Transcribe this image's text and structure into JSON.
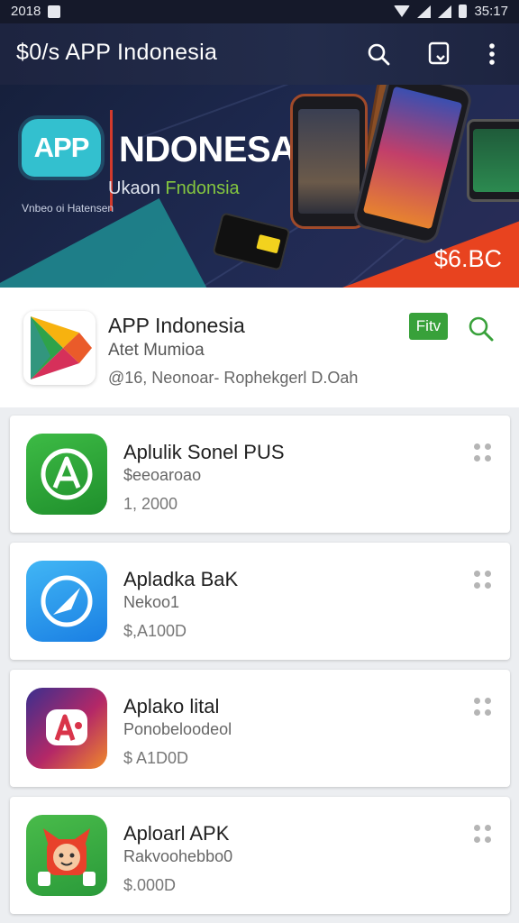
{
  "status_bar": {
    "time_left": "2018",
    "time_right": "35:17"
  },
  "appbar": {
    "title": "$0/s APP  Indonesia",
    "icons": [
      "search-icon",
      "bookmark-icon",
      "more-vert-icon"
    ]
  },
  "banner": {
    "badge": "APP",
    "headline": "NDONESA",
    "sub_prefix": "Ukaon ",
    "sub_accent": "Fndonsia",
    "tagline": "Vnbeo oi Hatensen",
    "price": "$6.BC"
  },
  "featured": {
    "name": "APP Indonesia",
    "developer": "Atet Mumioa",
    "meta": "@16, Neonoar- Rophekgerl D.Oah",
    "install_label": "Fitv"
  },
  "apps": [
    {
      "name": "Aplulik Sonel PUS",
      "sub": "$eeoaroao",
      "price": "1, 2000"
    },
    {
      "name": "Apladka BaK",
      "sub": "Nekoo1",
      "price": "$,A100D"
    },
    {
      "name": "Aplako lital",
      "sub": "Ponobeloodeol",
      "price": "$ A1D0D"
    },
    {
      "name": "Aploarl APK",
      "sub": "Rakvoohebbo0",
      "price": "$.000D"
    }
  ],
  "colors": {
    "appbar_bg": "#1d2440",
    "install_green": "#38a13a",
    "banner_orange": "#e8431f",
    "banner_teal": "#33c0cf"
  }
}
